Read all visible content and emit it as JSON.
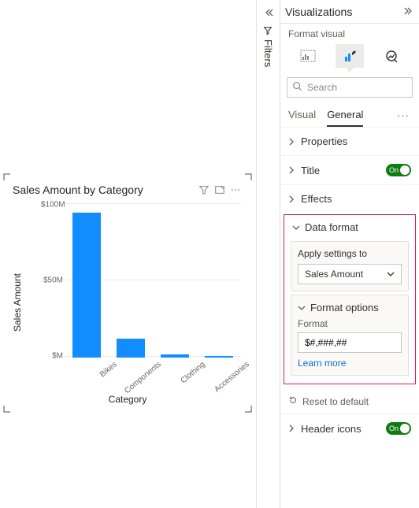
{
  "chart_data": {
    "type": "bar",
    "title": "Sales Amount by Category",
    "categories": [
      "Bikes",
      "Components",
      "Clothing",
      "Accessories"
    ],
    "values": [
      94,
      12,
      2,
      1
    ],
    "series_name": "Sales Amount",
    "xlabel": "Category",
    "ylabel": "Sales Amount",
    "ylim": [
      0,
      100
    ],
    "y_ticks": [
      "$100M",
      "$50M",
      "$M"
    ],
    "unit": "$M"
  },
  "colors": {
    "bar_fill": "#118dff",
    "accent_toggle": "#107c10",
    "warning_outline": "#d81b60"
  },
  "filters": {
    "label": "Filters"
  },
  "viz": {
    "title": "Visualizations",
    "subtitle": "Format visual",
    "search_placeholder": "Search",
    "tabs": {
      "visual": "Visual",
      "general": "General"
    },
    "sections": {
      "properties": "Properties",
      "title": "Title",
      "effects": "Effects",
      "data_format": "Data format",
      "header_icons": "Header icons"
    },
    "data_format": {
      "apply_to_label": "Apply settings to",
      "apply_to_value": "Sales Amount",
      "format_options_label": "Format options",
      "format_label": "Format",
      "format_value": "$#,###,##",
      "learn_more": "Learn more"
    },
    "toggle_on": "On",
    "reset": "Reset to default"
  }
}
